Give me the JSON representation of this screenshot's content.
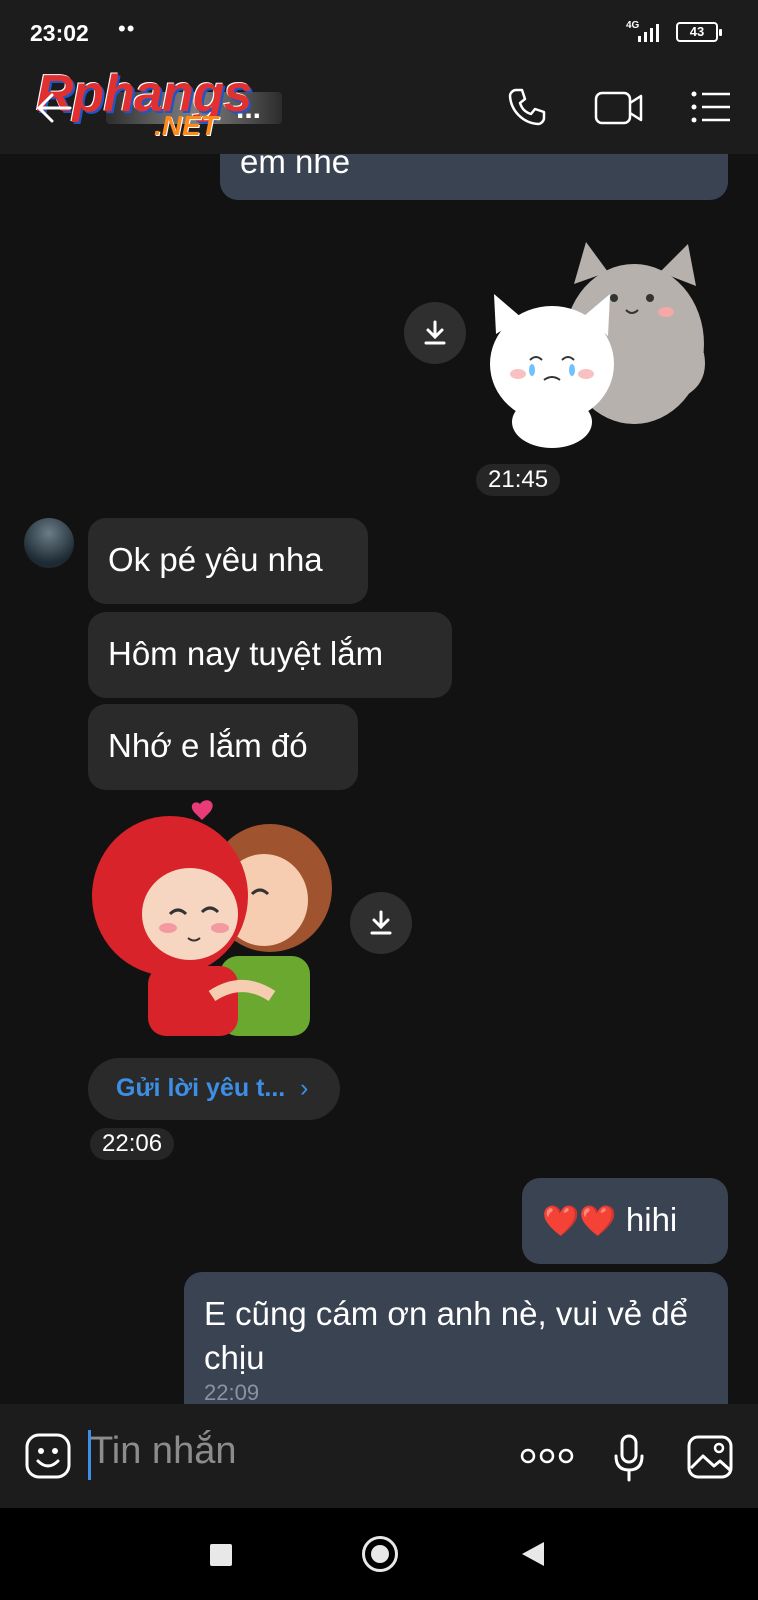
{
  "status": {
    "time": "23:02",
    "dots": "••",
    "network": "4G",
    "battery": "43"
  },
  "header": {
    "logo_main": "Rphangs",
    "logo_net": ".NET",
    "name_suffix": "..."
  },
  "messages": {
    "top_out": "em nhé",
    "sticker_time": "21:45",
    "in1": "Ok pé yêu nha",
    "in2": "Hôm nay tuyệt lắm",
    "in3": "Nhớ e lắm đó",
    "link_label": "Gửi lời yêu t...",
    "link_chevron": "›",
    "time2": "22:06",
    "out_hearts": "❤️❤️",
    "out_hihi": "hihi",
    "out_long": "E cũng cám ơn anh nè, vui vẻ dể chịu",
    "out_long_time": "22:09"
  },
  "composer": {
    "placeholder": "Tin nhắn"
  },
  "colors": {
    "accent": "#3d8fe6",
    "outgoing_bubble": "#3a4352",
    "incoming_bubble": "#2a2a2a"
  }
}
